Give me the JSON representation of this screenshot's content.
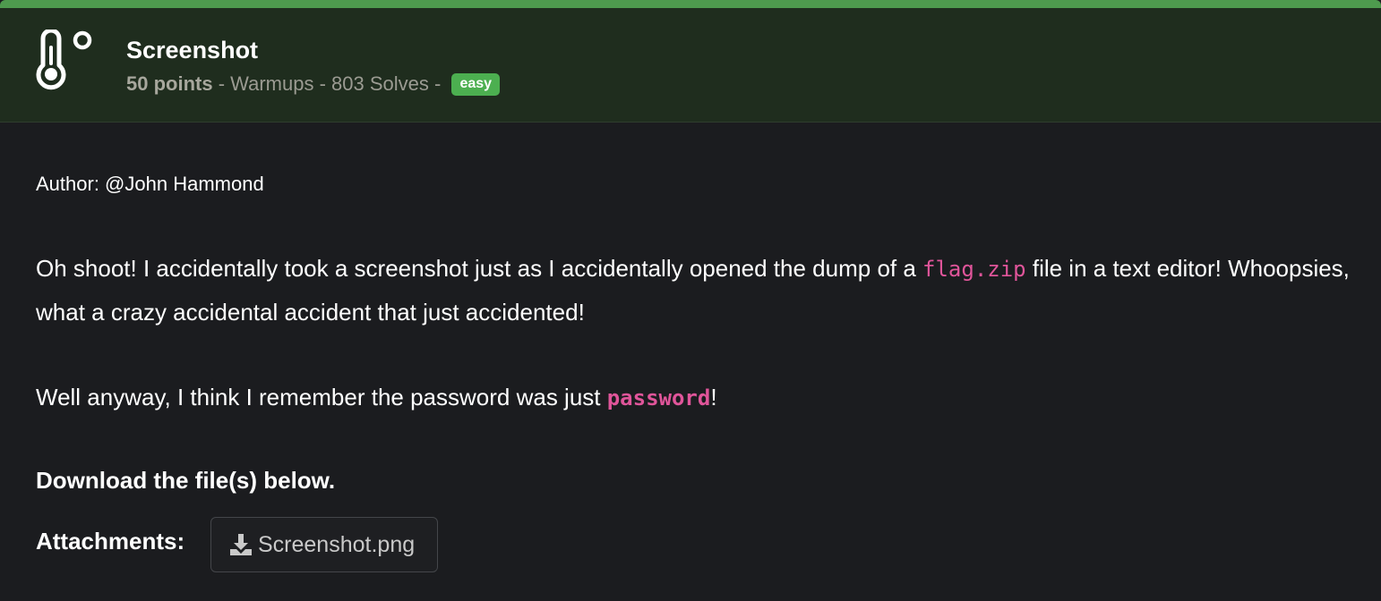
{
  "challenge": {
    "title": "Screenshot",
    "points": "50 points",
    "category": "Warmups",
    "solves": "803 Solves",
    "separator": " - ",
    "difficulty": "easy",
    "icon": "thermometer-icon"
  },
  "body": {
    "author": "Author: @John Hammond",
    "paragraph1_part1": "Oh shoot! I accidentally took a screenshot just as I accidentally opened the dump of a ",
    "paragraph1_code": "flag.zip",
    "paragraph1_part2": " file in a text editor! Whoopsies, what a crazy accidental accident that just accidented!",
    "paragraph2_part1": "Well anyway, I think I remember the password was just ",
    "paragraph2_code": "password",
    "paragraph2_part2": "!",
    "download_heading": "Download the file(s) below.",
    "attachments_label": "Attachments:",
    "attachments": [
      {
        "label": "Screenshot.png",
        "icon": "download-icon"
      }
    ]
  },
  "colors": {
    "accent": "#4e9a4e",
    "header_bg": "#1f2d1e",
    "page_bg": "#1b1c1f",
    "badge_easy": "#4caf50",
    "code_pink": "#e0559a"
  }
}
